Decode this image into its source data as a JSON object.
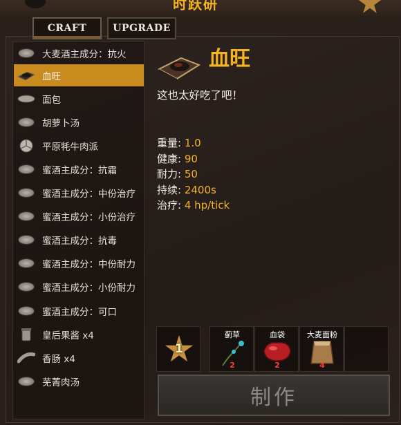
{
  "header": {
    "title": "时跃研"
  },
  "tabs": [
    {
      "label": "CRAFT",
      "active": true
    },
    {
      "label": "UPGRADE",
      "active": false
    }
  ],
  "recipes": [
    {
      "label": "大麦酒主成分：抗火",
      "icon": "bowl-icon"
    },
    {
      "label": "血旺",
      "icon": "blood-pudding-icon",
      "selected": true
    },
    {
      "label": "面包",
      "icon": "bread-icon"
    },
    {
      "label": "胡萝卜汤",
      "icon": "bowl-icon"
    },
    {
      "label": "平原牦牛肉派",
      "icon": "pie-icon"
    },
    {
      "label": "蜜酒主成分：抗霜",
      "icon": "bowl-icon"
    },
    {
      "label": "蜜酒主成分：中份治疗",
      "icon": "bowl-icon"
    },
    {
      "label": "蜜酒主成分：小份治疗",
      "icon": "bowl-icon"
    },
    {
      "label": "蜜酒主成分：抗毒",
      "icon": "bowl-icon"
    },
    {
      "label": "蜜酒主成分：中份耐力",
      "icon": "bowl-icon"
    },
    {
      "label": "蜜酒主成分：小份耐力",
      "icon": "bowl-icon"
    },
    {
      "label": "蜜酒主成分：可口",
      "icon": "bowl-icon"
    },
    {
      "label": "皇后果酱",
      "count": "x4",
      "icon": "jar-icon"
    },
    {
      "label": "香肠",
      "count": "x4",
      "icon": "sausage-icon"
    },
    {
      "label": "芜菁肉汤",
      "icon": "bowl-icon"
    }
  ],
  "detail": {
    "title": "血旺",
    "description": "这也太好吃了吧！",
    "stats": [
      {
        "key": "重量",
        "value": "1.0"
      },
      {
        "key": "健康",
        "value": "90"
      },
      {
        "key": "耐力",
        "value": "50"
      },
      {
        "key": "持续",
        "value": "2400s"
      },
      {
        "key": "治疗",
        "value": "4 hp/tick"
      }
    ]
  },
  "requirements": {
    "station_level": "1",
    "ingredients": [
      {
        "name": "蓟草",
        "qty": "2",
        "icon": "thistle-icon"
      },
      {
        "name": "血袋",
        "qty": "2",
        "icon": "bloodbag-icon"
      },
      {
        "name": "大麦面粉",
        "qty": "4",
        "icon": "barley-flour-icon"
      }
    ]
  },
  "craft_button": {
    "label": "制作"
  },
  "colors": {
    "accent": "#f5b324",
    "selected_bg": "#c98a1e",
    "qty_red": "#ff3b3b"
  }
}
